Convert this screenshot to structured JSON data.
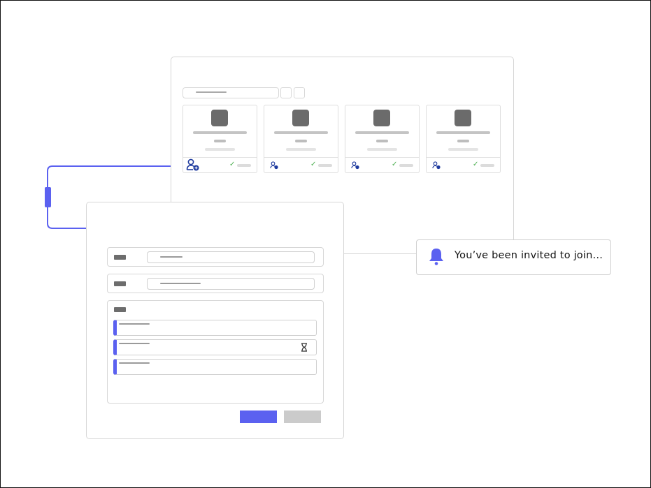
{
  "colors": {
    "accent": "#5b61f0",
    "check": "#4caf50",
    "placeholder_dark": "#6b6b6b",
    "placeholder_light": "#d9d9d9",
    "icon_blue": "#1e3a9e"
  },
  "cards": [
    {
      "icon": "add-user-icon",
      "status_icon": "check-icon"
    },
    {
      "icon": "add-user-icon",
      "status_icon": "check-icon"
    },
    {
      "icon": "add-user-icon",
      "status_icon": "check-icon"
    },
    {
      "icon": "add-user-icon",
      "status_icon": "check-icon"
    }
  ],
  "dialog": {
    "list_items": [
      {
        "status_icon": null
      },
      {
        "status_icon": "hourglass-icon"
      },
      {
        "status_icon": null
      }
    ]
  },
  "notification": {
    "icon": "bell-icon",
    "text": "You’ve been invited to join…"
  }
}
